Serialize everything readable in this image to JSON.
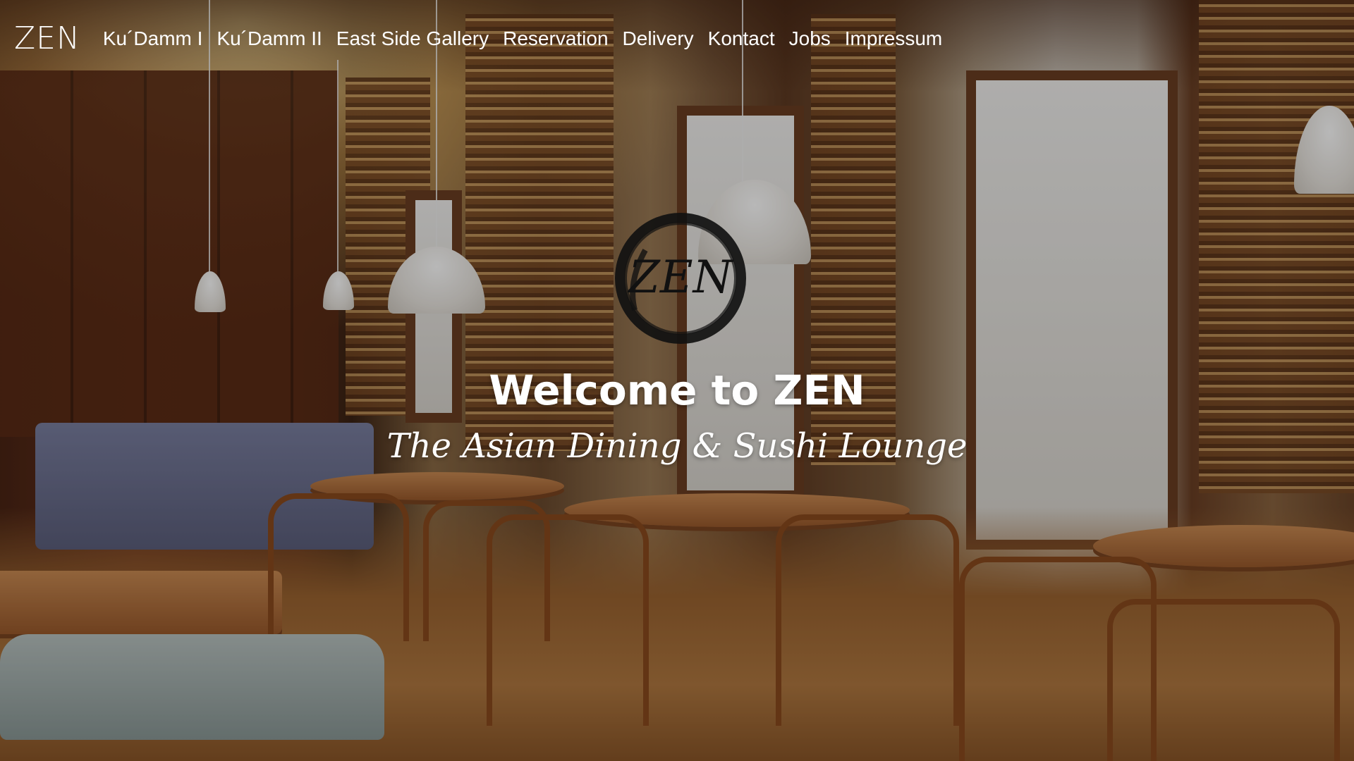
{
  "nav": {
    "brand": "ZEN",
    "links": [
      {
        "label": "Ku´Damm I"
      },
      {
        "label": "Ku´Damm II"
      },
      {
        "label": "East Side Gallery"
      },
      {
        "label": "Reservation"
      },
      {
        "label": "Delivery"
      },
      {
        "label": "Kontact"
      },
      {
        "label": "Jobs"
      },
      {
        "label": "Impressum"
      }
    ]
  },
  "hero": {
    "logo_text": "ZEN",
    "title": "Welcome to ZEN",
    "subtitle": "The Asian Dining & Sushi Lounge"
  },
  "colors": {
    "text": "#ffffff",
    "wood": "#6b3420"
  }
}
